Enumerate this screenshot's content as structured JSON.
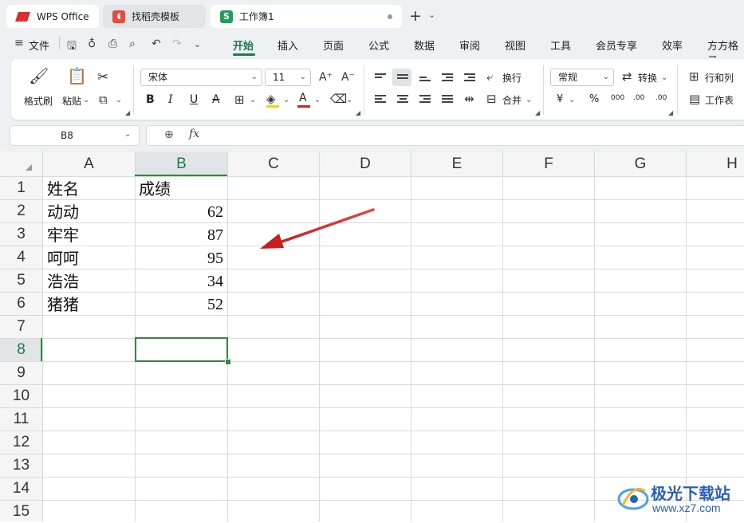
{
  "tabs": {
    "wps": "WPS Office",
    "template": "找稻壳模板",
    "workbook": "工作簿1"
  },
  "menu": {
    "file": "文件",
    "items": [
      "开始",
      "插入",
      "页面",
      "公式",
      "数据",
      "审阅",
      "视图",
      "工具",
      "会员专享",
      "效率",
      "方方格子"
    ]
  },
  "ribbon": {
    "format_painter": "格式刷",
    "paste": "粘贴",
    "font_name": "宋体",
    "font_size": "11",
    "bold": "B",
    "italic": "I",
    "underline": "U",
    "strike": "A",
    "wrap_text": "换行",
    "merge": "合并",
    "number_format": "常规",
    "convert": "转换",
    "row_col": "行和列",
    "worksheet": "工作表",
    "currency": "¥",
    "percent": "%",
    "thousands": "000",
    "inc_decimal": ".00",
    "dec_decimal": ".00"
  },
  "formula_bar": {
    "cell_ref": "B8",
    "fx": "fx",
    "content": ""
  },
  "columns": [
    "A",
    "B",
    "C",
    "D",
    "E",
    "F",
    "G",
    "H"
  ],
  "rows": [
    "1",
    "2",
    "3",
    "4",
    "5",
    "6",
    "7",
    "8",
    "9",
    "10",
    "11",
    "12",
    "13",
    "14",
    "15"
  ],
  "cells": {
    "A1": "姓名",
    "B1": "成绩",
    "A2": "动动",
    "B2": "62",
    "A3": "牢牢",
    "B3": "87",
    "A4": "呵呵",
    "B4": "95",
    "A5": "浩浩",
    "B5": "34",
    "A6": "猪猪",
    "B6": "52"
  },
  "selected_cell": "B8",
  "watermark": {
    "name": "极光下载站",
    "url": "www.xz7.com"
  },
  "colors": {
    "accent": "#1f7a4e",
    "selection": "#2e8b3c",
    "arrow": "#d42a2a"
  }
}
